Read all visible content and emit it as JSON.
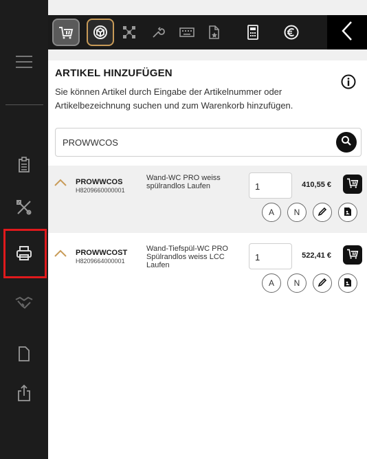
{
  "sidebar": {
    "icons": [
      "menu-icon",
      "clipboard-icon",
      "tools-icon",
      "printer-icon",
      "handshake-icon",
      "document-icon",
      "share-icon"
    ],
    "selected": "printer-icon",
    "highlight_color": "#e0191c"
  },
  "topbar": {
    "icons": [
      "cart-icon",
      "box-icon",
      "network-icon",
      "wrench-icon",
      "keyboard-icon",
      "document-star-icon",
      "calculator-icon",
      "euro-icon"
    ],
    "active": [
      "cart-icon",
      "box-icon"
    ],
    "back": "chevron-left-icon"
  },
  "panel": {
    "title": "ARTIKEL HINZUFÜGEN",
    "description": "Sie können Artikel durch Eingabe der Artikelnummer oder Artikelbezeichnung suchen und zum Warenkorb hinzufügen.",
    "search_value": "PROWWCOS"
  },
  "results": [
    {
      "code": "PROWWCOS",
      "article_number": "H8209660000001",
      "name": "Wand-WC PRO weiss spülrandlos Laufen",
      "quantity": "1",
      "price": "410,55 €",
      "btn_a": "A",
      "btn_n": "N"
    },
    {
      "code": "PROWWCOST",
      "article_number": "H8209664000001",
      "name": "Wand-Tiefspül-WC PRO Spülrandlos weiss LCC Laufen",
      "quantity": "1",
      "price": "522,41 €",
      "btn_a": "A",
      "btn_n": "N"
    }
  ],
  "colors": {
    "accent_gold": "#c89b58",
    "dark": "#1a1a1a"
  }
}
